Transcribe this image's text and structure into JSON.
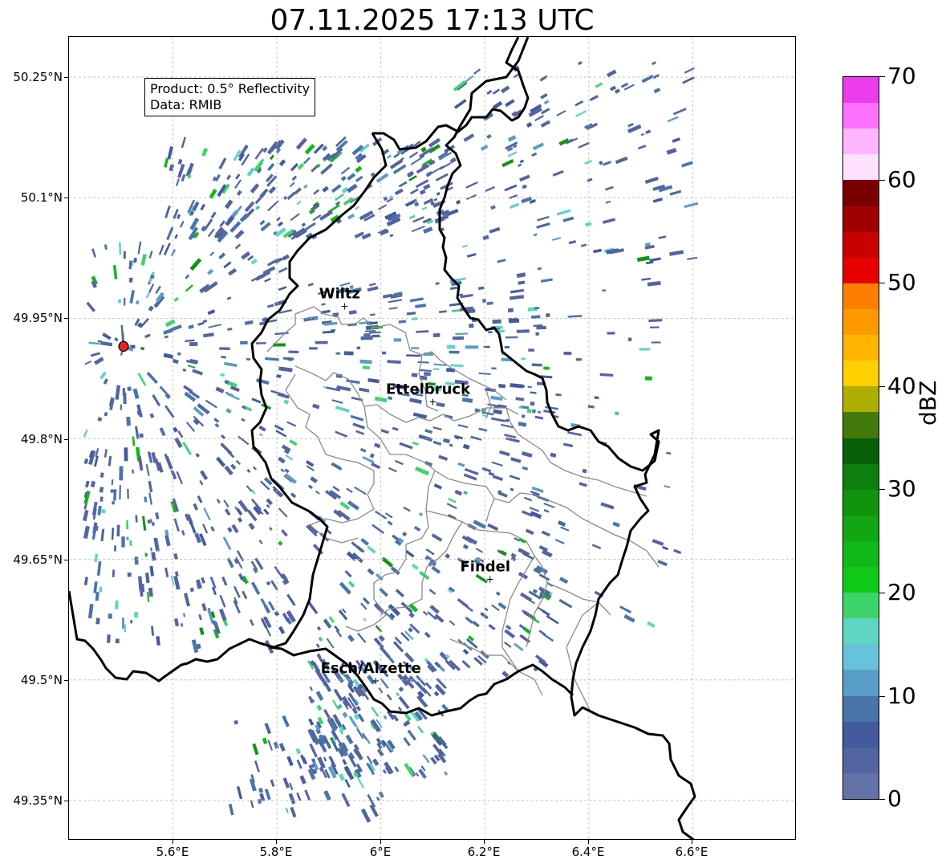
{
  "title": "07.11.2025 17:13 UTC",
  "info": {
    "product": "Product: 0.5° Reflectivity",
    "data_source": "Data: RMIB"
  },
  "axes": {
    "lon_ticks": [
      "5.6°E",
      "5.8°E",
      "6°E",
      "6.2°E",
      "6.4°E",
      "6.6°E"
    ],
    "lat_ticks": [
      "50.25°N",
      "50.1°N",
      "49.95°N",
      "49.8°N",
      "49.65°N",
      "49.5°N",
      "49.35°N"
    ],
    "lon_range": [
      5.4,
      6.8
    ],
    "lat_range": [
      49.3,
      50.3
    ]
  },
  "cities": [
    {
      "name": "Wiltz",
      "lon": 5.93,
      "lat": 49.966
    },
    {
      "name": "Ettelbruck",
      "lon": 6.1,
      "lat": 49.847
    },
    {
      "name": "Findel",
      "lon": 6.21,
      "lat": 49.626
    },
    {
      "name": "Esch/Alzette",
      "lon": 5.99,
      "lat": 49.5
    }
  ],
  "radar_site": {
    "lon": 5.505,
    "lat": 49.915,
    "marker_color": "#e8231a"
  },
  "colorbar": {
    "unit": "dBZ",
    "range": [
      0,
      70
    ],
    "tick_labels": [
      "0",
      "10",
      "20",
      "30",
      "40",
      "50",
      "60",
      "70"
    ],
    "colors": [
      "#6373a8",
      "#5365a0",
      "#435a9f",
      "#4a74ab",
      "#599ec6",
      "#67c2dc",
      "#5fd5c4",
      "#3dd56b",
      "#10c818",
      "#11b818",
      "#10a614",
      "#10940e",
      "#0e7f0e",
      "#075f07",
      "#427b0b",
      "#adb002",
      "#fed000",
      "#feb400",
      "#fe9a00",
      "#fe7e00",
      "#e80000",
      "#c90000",
      "#a00000",
      "#7a0000",
      "#fee1fe",
      "#feb6fe",
      "#fe71fe",
      "#ec3cec"
    ]
  }
}
